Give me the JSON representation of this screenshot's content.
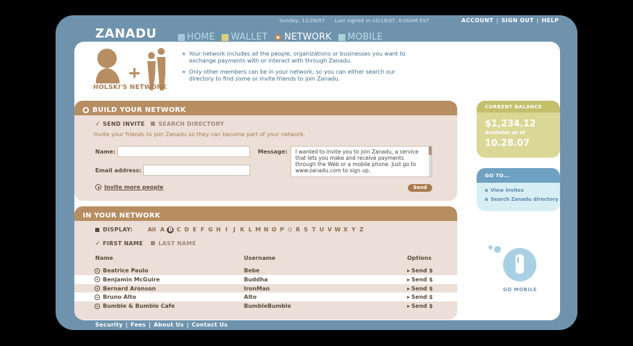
{
  "header": {
    "date": "Sunday, 11/28/07",
    "last_signed": "Last signed in:10/19/07, 0:00AM EST",
    "account": "ACCOUNT",
    "sign_out": "SIGN OUT",
    "help": "HELP"
  },
  "brand": {
    "logo": "ZANADU"
  },
  "nav": {
    "home": "HOME",
    "wallet": "WALLET",
    "network": "NETWORK",
    "mobile": "MOBILE"
  },
  "hero": {
    "title": "HOLSKI'S NETWORK",
    "bullet1": "Your network includes all the people, organizations or businesses you want to exchange payments with or interact with through Zanadu.",
    "bullet2": "Only other members can be in your network, so you can either search our directory to find some or invite friends to join Zanadu."
  },
  "build": {
    "heading": "BUILD YOUR NETWORK",
    "tab_send": "SEND INVITE",
    "tab_search": "SEARCH DIRECTORY",
    "intro": "Invite your friends to join Zanadu so they can become part of your network.",
    "name_label": "Name:",
    "email_label": "Email address:",
    "message_label": "Message:",
    "message_text": "I wanted to invite you to join Zanadu, a service that lets you make and receive payments through the Web or a mobile phone. Just go to www.zanadu.com to sign up,",
    "invite_more": "Invite more people",
    "send": "Send"
  },
  "network": {
    "heading": "IN YOUR NETWORK",
    "display_label": "DISPLAY:",
    "letters": [
      "All",
      "A",
      "B",
      "C",
      "D",
      "E",
      "F",
      "G",
      "H",
      "I",
      "J",
      "K",
      "L",
      "M",
      "N",
      "O",
      "P",
      "Q",
      "R",
      "S",
      "T",
      "U",
      "V",
      "W",
      "X",
      "Y",
      "Z"
    ],
    "selected_letter": "B",
    "sort_first": "FIRST NAME",
    "sort_last": "LAST NAME",
    "col_name": "Name",
    "col_username": "Username",
    "col_options": "Options",
    "rows": [
      {
        "name": "Beatrice Paulo",
        "username": "Bebe",
        "option": "Send $"
      },
      {
        "name": "Benjamin McGuire",
        "username": "Buddha",
        "option": "Send $"
      },
      {
        "name": "Bernard Aronson",
        "username": "IronMan",
        "option": "Send $"
      },
      {
        "name": "Bruno Alto",
        "username": "Alto",
        "option": "Send $"
      },
      {
        "name": "Bumble & Bumble Cafe",
        "username": "BumbleBumble",
        "option": "Send $"
      }
    ]
  },
  "balance": {
    "heading": "CURRENT BALANCE",
    "amount": "$1,234.12",
    "as_of": "Available as of",
    "date": "10.28.07"
  },
  "goto": {
    "heading": "GO TO...",
    "link1": "View invites",
    "link2": "Search Zanadu directory"
  },
  "mobile": {
    "label": "GO MOBILE"
  },
  "footer": {
    "security": "Security",
    "fees": "Fees",
    "about": "About Us",
    "contact": "Contact Us"
  },
  "colors": {
    "frame": "#6f93ad",
    "accent_brown": "#b78d62",
    "balance": "#dbd796",
    "goto": "#6fa1c0"
  }
}
